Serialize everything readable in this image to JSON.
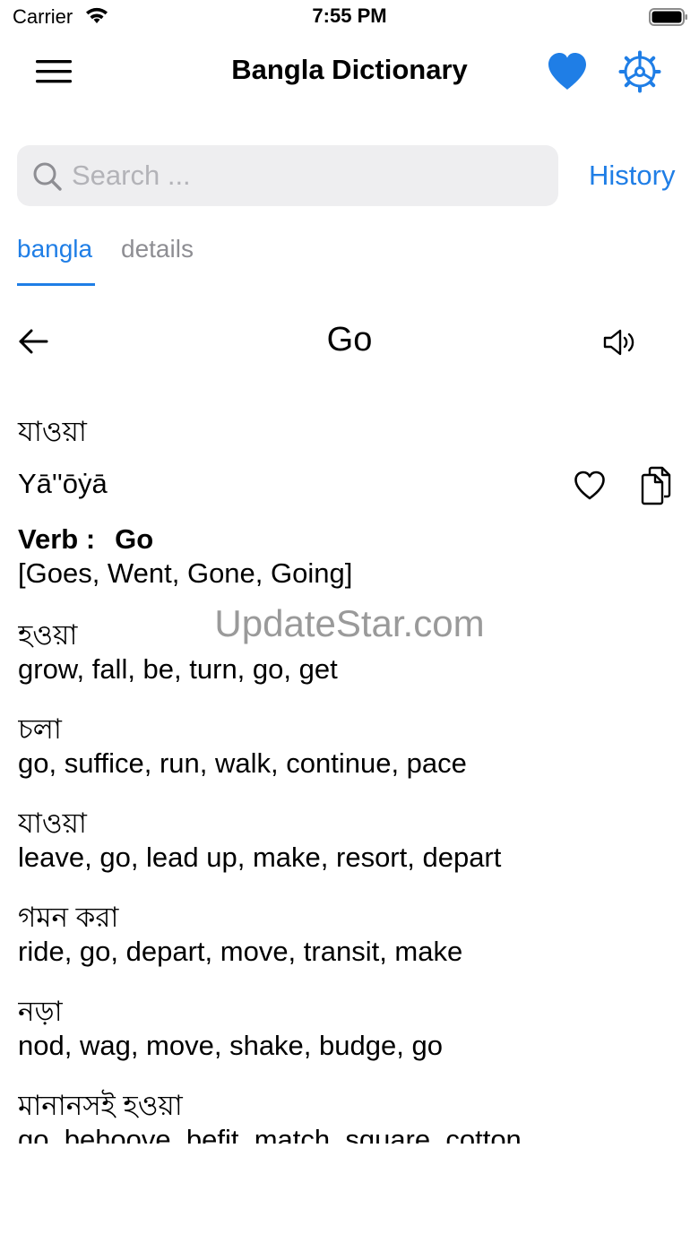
{
  "status": {
    "carrier": "Carrier",
    "time": "7:55 PM"
  },
  "nav": {
    "title": "Bangla Dictionary"
  },
  "search": {
    "placeholder": "Search ...",
    "history_label": "History"
  },
  "tabs": [
    {
      "label": "bangla",
      "active": true
    },
    {
      "label": "details",
      "active": false
    }
  ],
  "word": {
    "title": "Go",
    "bangla": "যাওয়া",
    "transliteration": "Yā''ōẏā",
    "pos_label": "Verb :",
    "pos_word": "Go",
    "forms": "[Goes, Went, Gone, Going]"
  },
  "watermark": "UpdateStar.com",
  "definitions": [
    {
      "bangla": "হওয়া",
      "english": "grow, fall, be, turn, go, get"
    },
    {
      "bangla": "চলা",
      "english": "go, suffice, run, walk, continue, pace"
    },
    {
      "bangla": "যাওয়া",
      "english": "leave, go, lead up, make, resort, depart"
    },
    {
      "bangla": "গমন করা",
      "english": "ride, go, depart, move, transit, make"
    },
    {
      "bangla": "নড়া",
      "english": "nod, wag, move, shake, budge, go"
    },
    {
      "bangla": "মানানসই হওয়া",
      "english": "go, behoove, befit, match, square, cotton"
    }
  ],
  "colors": {
    "accent": "#1f7ee6",
    "search_bg": "#eeeef0",
    "inactive_tab": "#8e8e93"
  }
}
